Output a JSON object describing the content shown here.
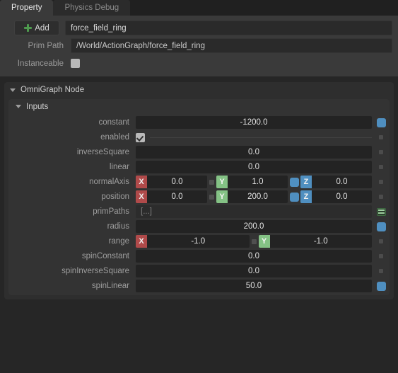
{
  "tabs": [
    {
      "label": "Property",
      "active": true
    },
    {
      "label": "Physics Debug",
      "active": false
    }
  ],
  "header": {
    "add_label": "Add",
    "name_value": "force_field_ring",
    "prim_path_label": "Prim Path",
    "prim_path_value": "/World/ActionGraph/force_field_ring",
    "instanceable_label": "Instanceable",
    "instanceable_checked": false
  },
  "section": {
    "title": "OmniGraph Node",
    "subsection_title": "Inputs"
  },
  "colors": {
    "axis_x": "#b04a4a",
    "axis_y": "#84c285",
    "axis_z": "#4f8fc0",
    "connected": "#4f8fc0",
    "array_icon": "#9ecf9f",
    "accent_plus": "#4e9a4e"
  },
  "rows": [
    {
      "label": "constant",
      "value": "-1200.0"
    },
    {
      "label": "enabled",
      "value": ""
    },
    {
      "label": "inverseSquare",
      "value": "0.0"
    },
    {
      "label": "linear",
      "value": "0.0"
    },
    {
      "label": "normalAxis",
      "x": "0.0",
      "y": "1.0",
      "z": "0.0"
    },
    {
      "label": "position",
      "x": "0.0",
      "y": "200.0",
      "z": "0.0"
    },
    {
      "label": "primPaths",
      "value": "[...]"
    },
    {
      "label": "radius",
      "value": "200.0"
    },
    {
      "label": "range",
      "x": "-1.0",
      "y": "-1.0"
    },
    {
      "label": "spinConstant",
      "value": "0.0"
    },
    {
      "label": "spinInverseSquare",
      "value": "0.0"
    },
    {
      "label": "spinLinear",
      "value": "50.0"
    }
  ]
}
